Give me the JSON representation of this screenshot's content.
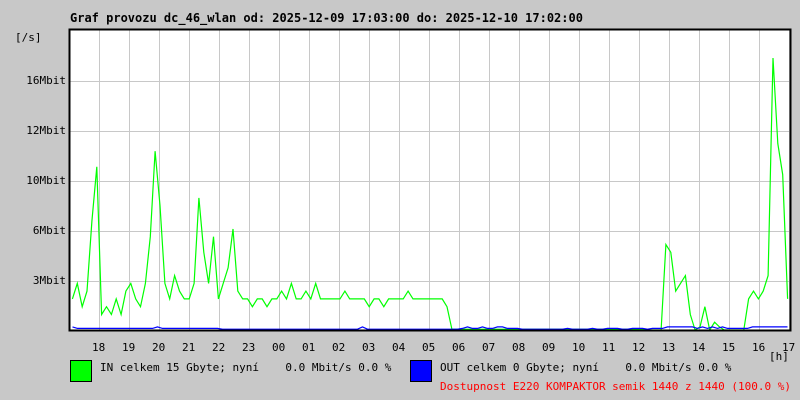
{
  "title": "Graf provozu dc_46_wlan od: 2025-12-09 17:03:00 do: 2025-12-10 17:02:00",
  "chart_data": {
    "type": "line",
    "title": "Graf provozu dc_46_wlan od: 2025-12-09 17:03:00 do: 2025-12-10 17:02:00",
    "ylabel": "[/s]",
    "xlabel": "[h]",
    "y_ticks": [
      {
        "label": "16Mbit",
        "value": 16
      },
      {
        "label": "12Mbit",
        "value": 12
      },
      {
        "label": "10Mbit",
        "value": 10
      },
      {
        "label": "6Mbit",
        "value": 6
      },
      {
        "label": "3Mbit",
        "value": 3
      }
    ],
    "x_ticks": [
      "18",
      "19",
      "20",
      "21",
      "22",
      "23",
      "00",
      "01",
      "02",
      "03",
      "04",
      "05",
      "06",
      "07",
      "08",
      "09",
      "10",
      "11",
      "12",
      "13",
      "14",
      "15",
      "16",
      "17"
    ],
    "ylim": [
      0,
      19.3
    ],
    "sample_minutes": 10,
    "grid": true,
    "series": [
      {
        "name": "IN",
        "color": "#00ff00",
        "values": [
          2,
          3,
          1.5,
          2.5,
          7,
          10.5,
          1,
          1.5,
          1,
          2,
          1,
          2.5,
          3,
          2,
          1.5,
          3,
          6,
          11.5,
          8,
          3,
          2,
          3.5,
          2.5,
          2,
          2,
          3,
          8.5,
          5,
          3,
          6,
          2,
          3,
          4,
          6.5,
          2.5,
          2,
          2,
          1.5,
          2,
          2,
          1.5,
          2,
          2,
          2.5,
          2,
          3,
          2,
          2,
          2.5,
          2,
          3,
          2,
          2,
          2,
          2,
          2,
          2.5,
          2,
          2,
          2,
          2,
          1.5,
          2,
          2,
          1.5,
          2,
          2,
          2,
          2,
          2.5,
          2,
          2,
          2,
          2,
          2,
          2,
          2,
          1.5,
          0.05,
          0.05,
          0.05,
          0.05,
          0.05,
          0.05,
          0.05,
          0.05,
          0.05,
          0.05,
          0.05,
          0.05,
          0.05,
          0.05,
          0.05,
          0.05,
          0.05,
          0.05,
          0.05,
          0.05,
          0.05,
          0.05,
          0.05,
          0.05,
          0.05,
          0.05,
          0.05,
          0.05,
          0.05,
          0.05,
          0.05,
          0.05,
          0.05,
          0.05,
          0.05,
          0.05,
          0.05,
          0.05,
          0.05,
          0.05,
          0,
          0,
          0,
          0,
          5.5,
          5,
          2.5,
          3,
          3.5,
          1,
          0,
          0.2,
          1.5,
          0,
          0.5,
          0.2,
          0,
          0,
          0,
          0,
          0,
          2,
          2.5,
          2,
          2.5,
          3.5,
          17.5,
          12,
          10,
          2
        ]
      },
      {
        "name": "OUT",
        "color": "#0000ff",
        "values": [
          0.2,
          0.1,
          0.1,
          0.1,
          0.1,
          0.1,
          0.1,
          0.1,
          0.1,
          0.1,
          0.1,
          0.1,
          0.1,
          0.1,
          0.1,
          0.1,
          0.1,
          0.2,
          0.1,
          0.1,
          0.1,
          0.1,
          0.1,
          0.1,
          0.1,
          0.1,
          0.1,
          0.1,
          0.1,
          0.1,
          0.05,
          0.05,
          0.05,
          0.05,
          0.05,
          0.05,
          0.05,
          0.05,
          0.05,
          0.05,
          0.05,
          0.05,
          0.05,
          0.05,
          0.05,
          0.05,
          0.05,
          0.05,
          0.05,
          0.05,
          0.05,
          0.05,
          0.05,
          0.05,
          0.05,
          0.05,
          0.05,
          0.05,
          0.2,
          0.05,
          0.05,
          0.05,
          0.05,
          0.05,
          0.05,
          0.05,
          0.05,
          0.05,
          0.05,
          0.05,
          0.05,
          0.05,
          0.05,
          0.05,
          0.05,
          0.05,
          0.05,
          0.05,
          0.1,
          0.2,
          0.1,
          0.1,
          0.2,
          0.1,
          0.1,
          0.2,
          0.2,
          0.1,
          0.1,
          0.1,
          0.05,
          0.05,
          0.05,
          0.05,
          0.05,
          0.05,
          0.05,
          0.05,
          0.05,
          0.1,
          0.05,
          0.05,
          0.05,
          0.05,
          0.1,
          0.05,
          0.05,
          0.1,
          0.1,
          0.1,
          0.05,
          0.05,
          0.1,
          0.1,
          0.1,
          0.05,
          0.1,
          0.1,
          0.1,
          0.2,
          0.2,
          0.2,
          0.2,
          0.2,
          0.2,
          0.1,
          0.2,
          0.1,
          0.2,
          0.1,
          0.2,
          0.1,
          0.1,
          0.1,
          0.1,
          0.1,
          0.2,
          0.2,
          0.2,
          0.2,
          0.2,
          0.2,
          0.2,
          0.2
        ]
      }
    ]
  },
  "legend": {
    "in": {
      "label": "IN celkem 15 Gbyte; nyní    0.0 Mbit/s 0.0 %",
      "color": "#00ff00"
    },
    "out": {
      "label": "OUT celkem 0 Gbyte; nyní    0.0 Mbit/s 0.0 %",
      "color": "#0000ff"
    },
    "availability": "Dostupnost E220 KOMPAKTOR semik 1440 z 1440 (100.0 %)"
  }
}
